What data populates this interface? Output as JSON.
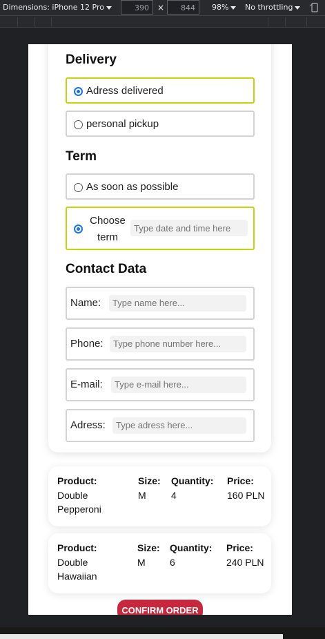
{
  "devtools": {
    "dimensions_label": "Dimensions: iPhone 12 Pro",
    "width": "390",
    "times": "×",
    "height": "844",
    "zoom": "98%",
    "throttling": "No throttling"
  },
  "delivery": {
    "heading": "Delivery",
    "options": [
      {
        "label": "Adress delivered",
        "selected": true
      },
      {
        "label": "personal pickup",
        "selected": false
      }
    ]
  },
  "term": {
    "heading": "Term",
    "asap_label": "As soon as possible",
    "choose_label": "Choose term",
    "choose_line1": "Choose",
    "choose_line2": "term",
    "date_placeholder": "Type date and time here"
  },
  "contact": {
    "heading": "Contact Data",
    "fields": [
      {
        "label": "Name:",
        "placeholder": "Type name here..."
      },
      {
        "label": "Phone:",
        "placeholder": "Type phone number here..."
      },
      {
        "label": "E-mail:",
        "placeholder": "Type e-mail here..."
      },
      {
        "label": "Adress:",
        "placeholder": "Type adress here..."
      }
    ]
  },
  "order": {
    "headers": {
      "product": "Product:",
      "size": "Size:",
      "quantity": "Quantity:",
      "price": "Price:"
    },
    "items": [
      {
        "product_line1": "Double",
        "product_line2": "Pepperoni",
        "size": "M",
        "quantity": "4",
        "price": "160 PLN"
      },
      {
        "product_line1": "Double",
        "product_line2": "Hawaiian",
        "size": "M",
        "quantity": "6",
        "price": "240 PLN"
      }
    ],
    "confirm_label": "CONFIRM ORDER"
  },
  "colors": {
    "selected_border": "#c6d40a",
    "radio_accent": "#1a73e8",
    "confirm_button": "#c8283e"
  }
}
